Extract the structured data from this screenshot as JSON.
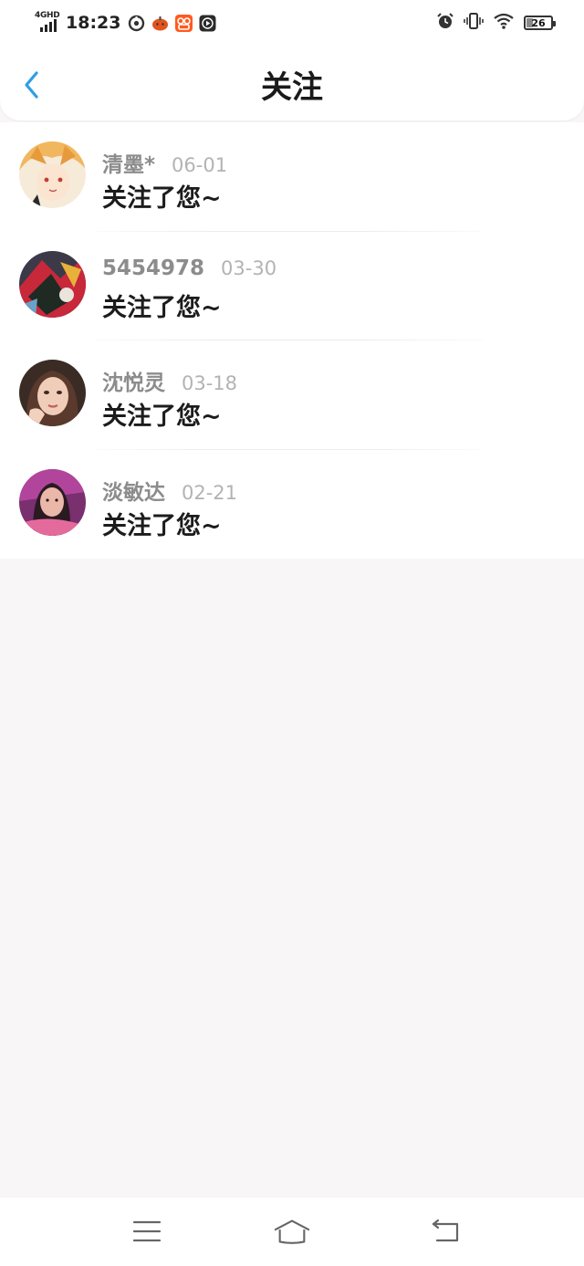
{
  "status_bar": {
    "network": "4GHD",
    "time": "18:23",
    "battery_level": "26",
    "battery_percent": 26,
    "left_icons": [
      "sync-icon",
      "pumpkin-app-icon",
      "kuaishou-app-icon",
      "video-app-icon"
    ],
    "right_icons": [
      "alarm-icon",
      "vibrate-icon",
      "wifi-icon",
      "battery-icon"
    ]
  },
  "header": {
    "title": "关注",
    "back_icon": "chevron-left-icon"
  },
  "colors": {
    "accent": "#2e9ee8",
    "name": "#8c8c8c",
    "date": "#b3b3b3",
    "message": "#1c1c1c",
    "background": "#f8f6f7"
  },
  "follows": [
    {
      "name": "清墨*",
      "date": "06-01",
      "message": "关注了您~"
    },
    {
      "name": "5454978",
      "date": "03-30",
      "message": "关注了您~"
    },
    {
      "name": "沈悦灵",
      "date": "03-18",
      "message": "关注了您~"
    },
    {
      "name": "淡敏达",
      "date": "02-21",
      "message": "关注了您~"
    }
  ],
  "nav_bar": {
    "icons": [
      "menu-icon",
      "home-icon",
      "back-icon"
    ]
  }
}
